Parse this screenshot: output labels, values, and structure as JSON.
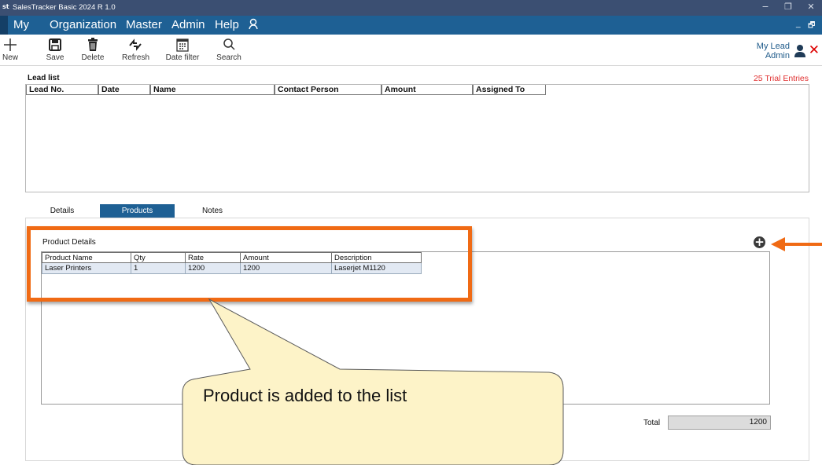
{
  "window": {
    "logo": "st",
    "title": "SalesTracker Basic 2024 R 1.0",
    "minimize": "−",
    "restore": "❐",
    "close": "✕"
  },
  "menu": {
    "items": [
      "My",
      "Organization",
      "Master",
      "Admin",
      "Help"
    ],
    "user_icon": "person-outline-icon",
    "right_minimize": "_",
    "right_restore": "🗗"
  },
  "toolbar": {
    "new_label": "New",
    "save_label": "Save",
    "delete_label": "Delete",
    "refresh_label": "Refresh",
    "datefilter_label": "Date filter",
    "search_label": "Search",
    "user_line1": "My Lead",
    "user_line2": "Admin",
    "close_glyph": "✕"
  },
  "lead_list": {
    "title": "Lead list",
    "trial_text": "25 Trial Entries",
    "columns": [
      "Lead No.",
      "Date",
      "Name",
      "Contact Person",
      "Amount",
      "Assigned To"
    ]
  },
  "tabs": [
    "Details",
    "Products",
    "Notes"
  ],
  "product_details": {
    "title": "Product Details",
    "columns": [
      "Product Name",
      "Qty",
      "Rate",
      "Amount",
      "Description"
    ],
    "rows": [
      [
        "Laser Printers",
        "1",
        "1200",
        "1200",
        "Laserjet M1120"
      ]
    ],
    "add_glyph": "+"
  },
  "total": {
    "label": "Total",
    "value": "1200"
  },
  "annotation": {
    "callout_text": "Product is added to the list",
    "highlight_color": "#f06a14",
    "callout_fill": "#fdf3c8"
  },
  "colors": {
    "titlebar": "#3b4f72",
    "menubar": "#1e6094",
    "active_tab": "#1e6094",
    "trial_red": "#e03030"
  }
}
